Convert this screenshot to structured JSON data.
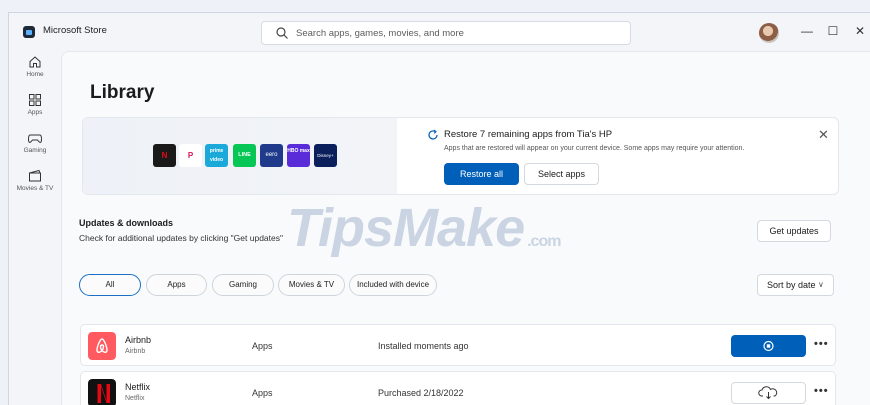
{
  "window": {
    "title": "Microsoft Store"
  },
  "search": {
    "placeholder": "Search apps, games, movies, and more"
  },
  "sidebar": {
    "items": [
      {
        "label": "Home",
        "icon": "home-icon"
      },
      {
        "label": "Apps",
        "icon": "apps-icon"
      },
      {
        "label": "Gaming",
        "icon": "gaming-icon"
      },
      {
        "label": "Movies & TV",
        "icon": "movies-icon"
      }
    ]
  },
  "page": {
    "title": "Library"
  },
  "restore": {
    "heading": "Restore 7 remaining apps from Tia's HP",
    "description": "Apps that are restored will appear on your current device. Some apps may require your attention.",
    "restore_all_label": "Restore all",
    "select_apps_label": "Select apps",
    "tiles": [
      {
        "name": "netflix-tile-icon",
        "text": "N",
        "color": "#1a1a1a",
        "fg": "#e50914"
      },
      {
        "name": "picsart-tile-icon",
        "text": "P",
        "color": "#ffffff",
        "fg": "#d4145a"
      },
      {
        "name": "prime-video-tile-icon",
        "text": "prime video",
        "color": "#1aa9d8",
        "fg": "#ffffff"
      },
      {
        "name": "line-tile-icon",
        "text": "LINE",
        "color": "#06c755",
        "fg": "#ffffff"
      },
      {
        "name": "eero-tile-icon",
        "text": "eero",
        "color": "#1f3a8a",
        "fg": "#ffffff"
      },
      {
        "name": "hbo-max-tile-icon",
        "text": "HBO max",
        "color": "#5a2bd8",
        "fg": "#ffffff"
      },
      {
        "name": "disney-plus-tile-icon",
        "text": "Disney+",
        "color": "#0b1f5c",
        "fg": "#ffffff"
      }
    ]
  },
  "updates": {
    "title": "Updates & downloads",
    "subtitle": "Check for additional updates by clicking \"Get updates\"",
    "get_updates_label": "Get updates"
  },
  "watermark": {
    "main": "TipsMake",
    "suffix": ".com"
  },
  "filters": [
    {
      "label": "All",
      "active": true
    },
    {
      "label": "Apps",
      "active": false
    },
    {
      "label": "Gaming",
      "active": false
    },
    {
      "label": "Movies & TV",
      "active": false
    },
    {
      "label": "Included with device",
      "active": false
    }
  ],
  "sort": {
    "label": "Sort by date"
  },
  "apps": [
    {
      "name": "Airbnb",
      "publisher": "Airbnb",
      "category": "Apps",
      "status": "Installed moments ago",
      "action": "stop",
      "logo_color": "#ff5a5f"
    },
    {
      "name": "Netflix",
      "publisher": "Netflix",
      "category": "Apps",
      "status": "Purchased 2/18/2022",
      "action": "download",
      "logo_color": "#111111"
    }
  ],
  "colors": {
    "accent": "#005fb8",
    "background": "#f3f5f9"
  }
}
